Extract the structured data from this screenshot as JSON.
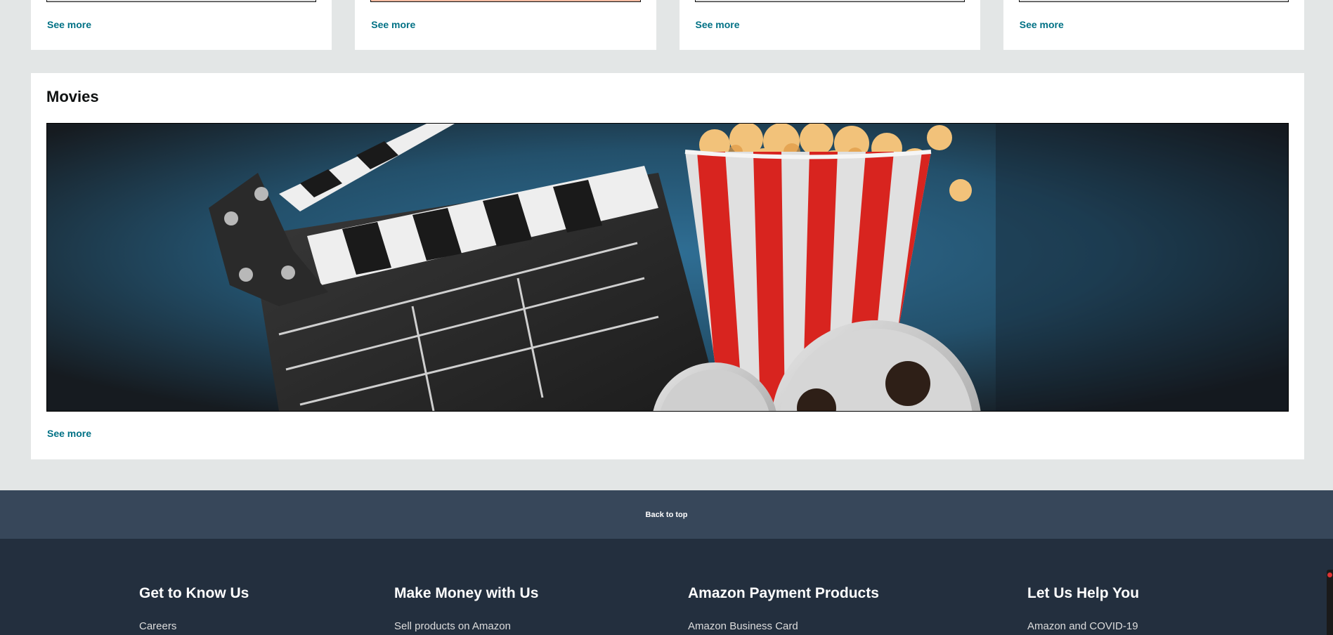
{
  "top_cards": [
    {
      "see_more": "See more"
    },
    {
      "see_more": "See more"
    },
    {
      "see_more": "See more"
    },
    {
      "see_more": "See more"
    }
  ],
  "movies": {
    "title": "Movies",
    "see_more": "See more"
  },
  "back_to_top": "Back to top",
  "footer": {
    "columns": [
      {
        "heading": "Get to Know Us",
        "first_link": "Careers"
      },
      {
        "heading": "Make Money with Us",
        "first_link": "Sell products on Amazon"
      },
      {
        "heading": "Amazon Payment Products",
        "first_link": "Amazon Business Card"
      },
      {
        "heading": "Let Us Help You",
        "first_link": "Amazon and COVID-19"
      }
    ]
  },
  "colors": {
    "page_bg": "#e3e6e6",
    "link": "#007185",
    "back_to_top_bg": "#37475a",
    "footer_bg": "#232f3e"
  }
}
